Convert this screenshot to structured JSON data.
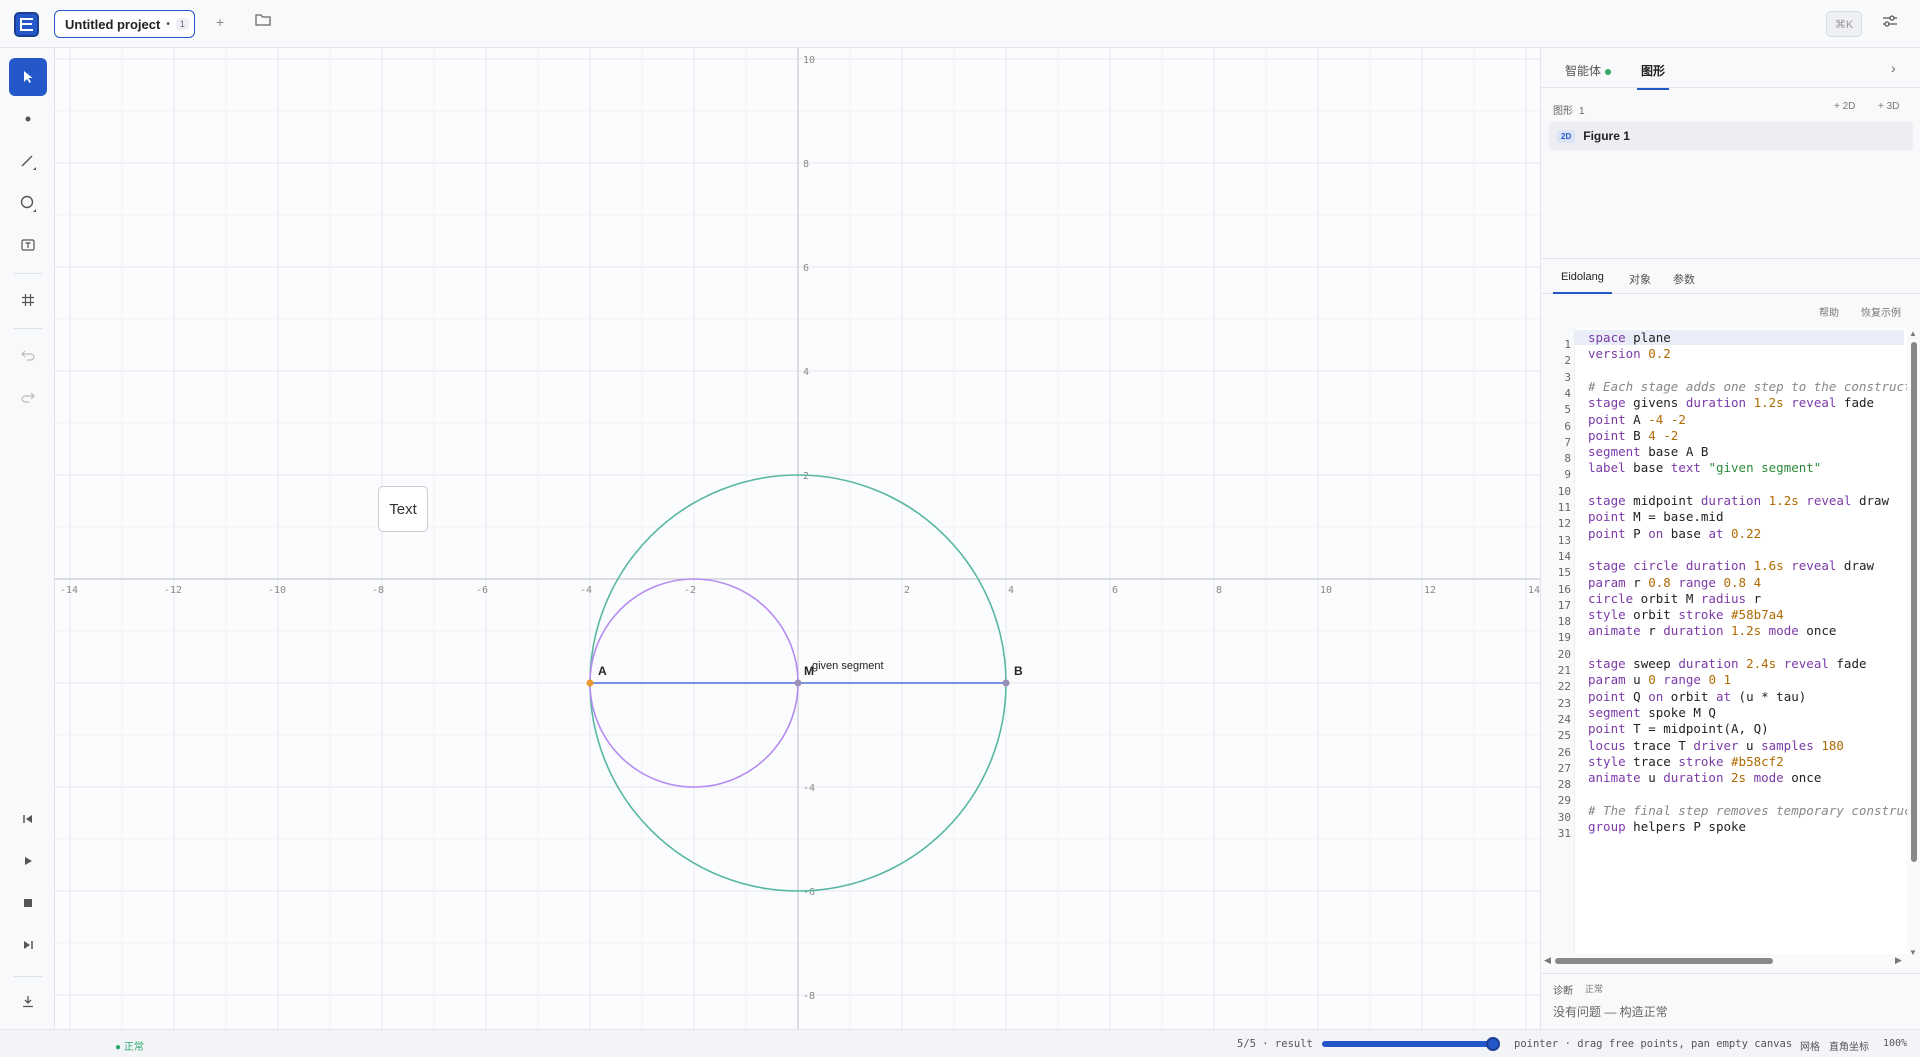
{
  "topbar": {
    "project_name": "Untitled project",
    "project_dot": "•",
    "project_badge": "1",
    "shortcut_hint": "⌘K"
  },
  "tool_icons": [
    "pointer-icon",
    "point-icon",
    "segment-icon",
    "circle-icon",
    "text-icon",
    "grid-icon",
    "undo-icon",
    "redo-icon",
    "skip-start-icon",
    "play-icon",
    "stop-icon",
    "skip-end-icon",
    "download-icon"
  ],
  "canvas": {
    "text_tool_label": "Text",
    "x_ticks": [
      "-14",
      "-12",
      "-10",
      "-8",
      "-6",
      "-4",
      "-2",
      "2",
      "4",
      "6",
      "8",
      "10",
      "12",
      "14"
    ],
    "y_ticks": [
      "10",
      "8",
      "6",
      "4",
      "2",
      "-4",
      "-6",
      "-8"
    ],
    "labels": {
      "A": "A",
      "M": "M",
      "B": "B",
      "segment": "given segment"
    },
    "colors": {
      "orbit": "#58b7a4",
      "trace": "#b58cf2",
      "segment": "#4a6fd8",
      "point_A": "#e89a2f",
      "point": "#9a8fb8"
    }
  },
  "right_panel": {
    "tabs": [
      "智能体",
      "图形"
    ],
    "figures_label": "图形",
    "figures_count": "1",
    "add_2d": "+ 2D",
    "add_3d": "+ 3D",
    "figure_pill": "2D",
    "figure_name": "Figure 1",
    "editor_tabs": [
      "Eidolang",
      "对象",
      "参数"
    ],
    "help": "帮助",
    "restore_example": "恢复示例",
    "diagnostics_title": "诊断",
    "diagnostics_status": "正常",
    "diagnostics_message": "没有问题 — 构造正常"
  },
  "code_lines": [
    "space plane",
    "version 0.2",
    "",
    "# Each stage adds one step to the construct",
    "stage givens duration 1.2s reveal fade",
    "point A -4 -2",
    "point B 4 -2",
    "segment base A B",
    "label base text \"given segment\"",
    "",
    "stage midpoint duration 1.2s reveal draw",
    "point M = base.mid",
    "point P on base at 0.22",
    "",
    "stage circle duration 1.6s reveal draw",
    "param r 0.8 range 0.8 4",
    "circle orbit M radius r",
    "style orbit stroke #58b7a4",
    "animate r duration 1.2s mode once",
    "",
    "stage sweep duration 2.4s reveal fade",
    "param u 0 range 0 1",
    "point Q on orbit at (u * tau)",
    "segment spoke M Q",
    "point T = midpoint(A, Q)",
    "locus trace T driver u samples 180",
    "style trace stroke #b58cf2",
    "animate u duration 2s mode once",
    "",
    "# The final step removes temporary construct",
    "group helpers P spoke"
  ],
  "statusbar": {
    "status": "● 正常",
    "progress": "5/5 · result",
    "progress_fraction": 1.0,
    "mode_hint": "pointer · drag free points, pan empty canvas",
    "grid": "网格",
    "coords": "直角坐标",
    "zoom": "100%"
  }
}
